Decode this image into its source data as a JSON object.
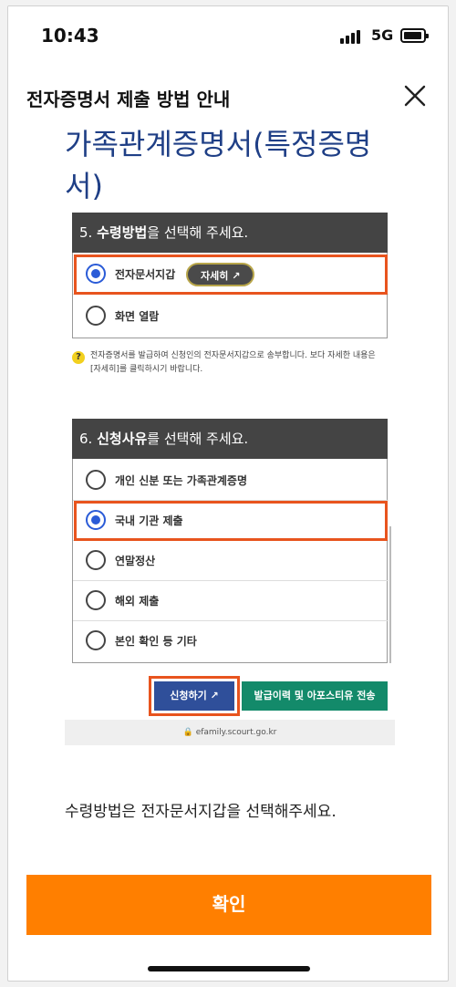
{
  "status_bar": {
    "time": "10:43",
    "network": "5G"
  },
  "header": {
    "title": "전자증명서 제출 방법 안내"
  },
  "document_title": "가족관계증명서(특정증명서)",
  "guide": {
    "section5": {
      "number": "5. ",
      "title_bold": "수령방법",
      "title_rest": "을 선택해 주세요.",
      "options": [
        {
          "label": "전자문서지갑",
          "selected": true
        },
        {
          "label": "화면 열람",
          "selected": false
        }
      ],
      "detail_button": "자세히 ↗"
    },
    "note": "전자증명서를 발급하여 신청인의 전자문서지갑으로 송부합니다. 보다 자세한 내용은 [자세히]를 클릭하시기 바랍니다.",
    "section6": {
      "number": "6. ",
      "title_bold": "신청사유",
      "title_rest": "를 선택해 주세요.",
      "options": [
        {
          "label": "개인 신분 또는 가족관계증명",
          "selected": false
        },
        {
          "label": "국내 기관 제출",
          "selected": true
        },
        {
          "label": "연말정산",
          "selected": false
        },
        {
          "label": "해외 제출",
          "selected": false
        },
        {
          "label": "본인 확인 등 기타",
          "selected": false
        }
      ]
    },
    "apply_button": "신청하기 ↗",
    "history_button": "발급이력 및 아포스티유 전송",
    "url": "🔒 efamily.scourt.go.kr"
  },
  "instruction": "수령방법은 전자문서지갑을 선택해주세요.",
  "confirm_button": "확인",
  "colors": {
    "accent": "#ff7f00",
    "title_blue": "#1f3f86",
    "highlight": "#e8541e"
  }
}
